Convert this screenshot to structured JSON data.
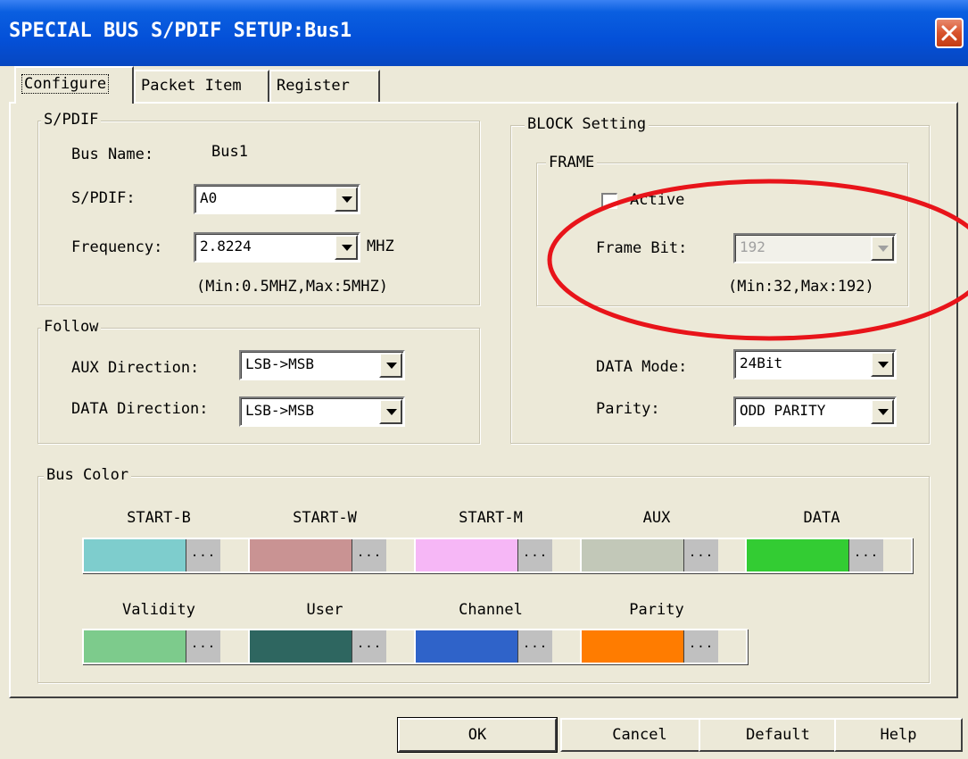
{
  "window": {
    "title": "SPECIAL BUS S/PDIF SETUP:Bus1"
  },
  "tabs": [
    {
      "label": "Configure",
      "active": true
    },
    {
      "label": "Packet Item",
      "active": false
    },
    {
      "label": "Register",
      "active": false
    }
  ],
  "spdif": {
    "group_title": "S/PDIF",
    "bus_name_label": "Bus Name:",
    "bus_name_value": "Bus1",
    "spdif_label": "S/PDIF:",
    "spdif_value": "A0",
    "frequency_label": "Frequency:",
    "frequency_value": "2.8224",
    "frequency_unit": "MHZ",
    "frequency_range": "(Min:0.5MHZ,Max:5MHZ)"
  },
  "follow": {
    "group_title": "Follow",
    "aux_direction_label": "AUX Direction:",
    "aux_direction_value": "LSB->MSB",
    "data_direction_label": "DATA Direction:",
    "data_direction_value": "LSB->MSB"
  },
  "block": {
    "group_title": "BLOCK Setting",
    "frame_title": "FRAME",
    "active_label": "Active",
    "active_checked": false,
    "frame_bit_label": "Frame Bit:",
    "frame_bit_value": "192",
    "frame_bit_range": "(Min:32,Max:192)",
    "data_mode_label": "DATA Mode:",
    "data_mode_value": "24Bit",
    "parity_label": "Parity:",
    "parity_value": "ODD PARITY"
  },
  "bus_color": {
    "group_title": "Bus Color",
    "button_label": "...",
    "items": [
      {
        "label": "START-B",
        "color": "#7ecdcd"
      },
      {
        "label": "START-W",
        "color": "#c99393"
      },
      {
        "label": "START-M",
        "color": "#f6b7f6"
      },
      {
        "label": "AUX",
        "color": "#c2c8b8"
      },
      {
        "label": "DATA",
        "color": "#33cc33"
      },
      {
        "label": "Validity",
        "color": "#7dcb8c"
      },
      {
        "label": "User",
        "color": "#2e6660"
      },
      {
        "label": "Channel",
        "color": "#2f63c9"
      },
      {
        "label": "Parity",
        "color": "#ff7c00"
      }
    ]
  },
  "buttons": {
    "ok": "OK",
    "cancel": "Cancel",
    "default": "Default",
    "help": "Help"
  }
}
